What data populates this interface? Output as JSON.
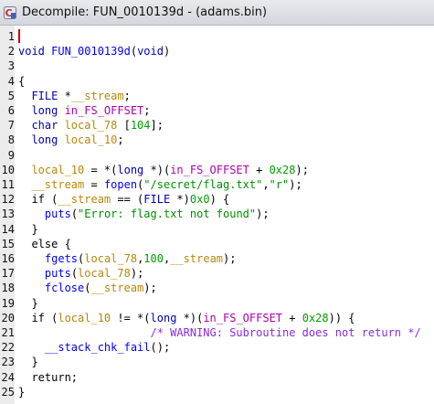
{
  "window": {
    "title": "Decompile: FUN_0010139d - (adams.bin)"
  },
  "colors": {
    "type": "#0000b0",
    "function": "#0000ff",
    "variable": "#b8860b",
    "global": "#b000b0",
    "number": "#00a000",
    "string": "#009000",
    "comment": "#8a2be2"
  },
  "lines": [
    {
      "n": "1",
      "tokens": []
    },
    {
      "n": "2",
      "tokens": [
        [
          "t",
          "void "
        ],
        [
          "f",
          "FUN_0010139d"
        ],
        [
          "p",
          "("
        ],
        [
          "t",
          "void"
        ],
        [
          "p",
          ")"
        ]
      ]
    },
    {
      "n": "3",
      "tokens": []
    },
    {
      "n": "4",
      "tokens": [
        [
          "p",
          "{"
        ]
      ]
    },
    {
      "n": "5",
      "tokens": [
        [
          "p",
          "  "
        ],
        [
          "t",
          "FILE"
        ],
        [
          "p",
          " *"
        ],
        [
          "v",
          "__stream"
        ],
        [
          "p",
          ";"
        ]
      ]
    },
    {
      "n": "6",
      "tokens": [
        [
          "p",
          "  "
        ],
        [
          "t",
          "long "
        ],
        [
          "g",
          "in_FS_OFFSET"
        ],
        [
          "p",
          ";"
        ]
      ]
    },
    {
      "n": "7",
      "tokens": [
        [
          "p",
          "  "
        ],
        [
          "t",
          "char "
        ],
        [
          "v",
          "local_78"
        ],
        [
          "p",
          " ["
        ],
        [
          "n",
          "104"
        ],
        [
          "p",
          "];"
        ]
      ]
    },
    {
      "n": "8",
      "tokens": [
        [
          "p",
          "  "
        ],
        [
          "t",
          "long "
        ],
        [
          "v",
          "local_10"
        ],
        [
          "p",
          ";"
        ]
      ]
    },
    {
      "n": "9",
      "tokens": []
    },
    {
      "n": "10",
      "tokens": [
        [
          "p",
          "  "
        ],
        [
          "v",
          "local_10"
        ],
        [
          "p",
          " = *("
        ],
        [
          "t",
          "long"
        ],
        [
          "p",
          " *)("
        ],
        [
          "g",
          "in_FS_OFFSET"
        ],
        [
          "p",
          " + "
        ],
        [
          "n",
          "0x28"
        ],
        [
          "p",
          ");"
        ]
      ]
    },
    {
      "n": "11",
      "tokens": [
        [
          "p",
          "  "
        ],
        [
          "v",
          "__stream"
        ],
        [
          "p",
          " = "
        ],
        [
          "f",
          "fopen"
        ],
        [
          "p",
          "("
        ],
        [
          "s",
          "\"/secret/flag.txt\""
        ],
        [
          "p",
          ","
        ],
        [
          "s",
          "\"r\""
        ],
        [
          "p",
          ");"
        ]
      ]
    },
    {
      "n": "12",
      "tokens": [
        [
          "p",
          "  if ("
        ],
        [
          "v",
          "__stream"
        ],
        [
          "p",
          " == ("
        ],
        [
          "t",
          "FILE"
        ],
        [
          "p",
          " *)"
        ],
        [
          "n",
          "0x0"
        ],
        [
          "p",
          ") {"
        ]
      ]
    },
    {
      "n": "13",
      "tokens": [
        [
          "p",
          "    "
        ],
        [
          "f",
          "puts"
        ],
        [
          "p",
          "("
        ],
        [
          "s",
          "\"Error: flag.txt not found\""
        ],
        [
          "p",
          ");"
        ]
      ]
    },
    {
      "n": "14",
      "tokens": [
        [
          "p",
          "  }"
        ]
      ]
    },
    {
      "n": "15",
      "tokens": [
        [
          "p",
          "  else {"
        ]
      ]
    },
    {
      "n": "16",
      "tokens": [
        [
          "p",
          "    "
        ],
        [
          "f",
          "fgets"
        ],
        [
          "p",
          "("
        ],
        [
          "v",
          "local_78"
        ],
        [
          "p",
          ","
        ],
        [
          "n",
          "100"
        ],
        [
          "p",
          ","
        ],
        [
          "v",
          "__stream"
        ],
        [
          "p",
          ");"
        ]
      ]
    },
    {
      "n": "17",
      "tokens": [
        [
          "p",
          "    "
        ],
        [
          "f",
          "puts"
        ],
        [
          "p",
          "("
        ],
        [
          "v",
          "local_78"
        ],
        [
          "p",
          ");"
        ]
      ]
    },
    {
      "n": "18",
      "tokens": [
        [
          "p",
          "    "
        ],
        [
          "f",
          "fclose"
        ],
        [
          "p",
          "("
        ],
        [
          "v",
          "__stream"
        ],
        [
          "p",
          ");"
        ]
      ]
    },
    {
      "n": "19",
      "tokens": [
        [
          "p",
          "  }"
        ]
      ]
    },
    {
      "n": "20",
      "tokens": [
        [
          "p",
          "  if ("
        ],
        [
          "v",
          "local_10"
        ],
        [
          "p",
          " != *("
        ],
        [
          "t",
          "long"
        ],
        [
          "p",
          " *)("
        ],
        [
          "g",
          "in_FS_OFFSET"
        ],
        [
          "p",
          " + "
        ],
        [
          "n",
          "0x28"
        ],
        [
          "p",
          ")) {"
        ]
      ]
    },
    {
      "n": "21",
      "tokens": [
        [
          "p",
          "                    "
        ],
        [
          "c",
          "/* WARNING: Subroutine does not return */"
        ]
      ]
    },
    {
      "n": "22",
      "tokens": [
        [
          "p",
          "    "
        ],
        [
          "f",
          "__stack_chk_fail"
        ],
        [
          "p",
          "();"
        ]
      ]
    },
    {
      "n": "23",
      "tokens": [
        [
          "p",
          "  }"
        ]
      ]
    },
    {
      "n": "24",
      "tokens": [
        [
          "p",
          "  return;"
        ]
      ]
    },
    {
      "n": "25",
      "tokens": [
        [
          "p",
          "}"
        ]
      ]
    }
  ]
}
